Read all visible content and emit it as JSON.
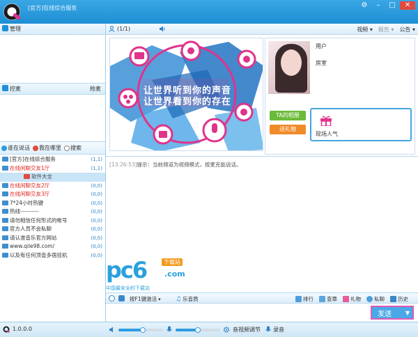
{
  "window": {
    "title": "[官方]在线综合服务",
    "controls": [
      "gear-icon",
      "minimize-icon",
      "maximize-icon",
      "close-icon"
    ]
  },
  "left_panel": {
    "admin_label": "管理",
    "mic_label": "控麦",
    "mic_right": "抢麦",
    "tabs": [
      {
        "label": "谁在说话",
        "icon": "speaker-icon",
        "color": "#2f9be0"
      },
      {
        "label": "我在哪里",
        "icon": "pin-icon",
        "color": "#e04a3f"
      },
      {
        "label": "搜索",
        "icon": "search-icon",
        "color": "#888888"
      }
    ],
    "rooms": [
      {
        "name": "[官方]在线综合服务",
        "count": "(1,1)",
        "style": "normal"
      },
      {
        "name": "在线闲聊交友1厅",
        "count": "(1,1)",
        "style": "red"
      },
      {
        "name": "软件大全",
        "count": "",
        "style": "sel"
      },
      {
        "name": "在线闲聊交友2厅",
        "count": "(0,0)",
        "style": "red"
      },
      {
        "name": "在线闲聊交友3厅",
        "count": "(0,0)",
        "style": "red"
      },
      {
        "name": "7*24小时热键",
        "count": "(0,0)",
        "style": "normal"
      },
      {
        "name": "热线----------",
        "count": "(0,0)",
        "style": "normal"
      },
      {
        "name": "请勿相信任何形式的帐号",
        "count": "(0,0)",
        "style": "normal"
      },
      {
        "name": "官方人员不会私聊",
        "count": "(0,0)",
        "style": "normal"
      },
      {
        "name": "请认准音乐官方网站",
        "count": "(0,0)",
        "style": "normal"
      },
      {
        "name": "www.qile98.com/",
        "count": "(0,0)",
        "style": "normal"
      },
      {
        "name": "以及有任何顶音多宿挂机",
        "count": "(0,0)",
        "style": "normal"
      }
    ]
  },
  "main": {
    "online_count": "(1/1)",
    "top_links": [
      {
        "label": "视频 ▾",
        "disabled": false
      },
      {
        "label": "报告 ▾",
        "disabled": true
      },
      {
        "label": "公告 ▾",
        "disabled": false
      }
    ],
    "banner": {
      "line1": "让世界听到你的声音",
      "line2": "让世界看到你的存在"
    },
    "profile": {
      "label_user": "用户",
      "label_rank": "房室"
    },
    "buttons": {
      "green": "TA的相册",
      "orange": "送礼物"
    },
    "popularity_label": "现场人气",
    "chat": {
      "timestamp": "[13:26:53]",
      "message": "提示：当前频道为视频模式，按麦克能说话。"
    },
    "watermark": {
      "brand": "pc6",
      "download": "下载站",
      "domain": ".com",
      "slogan": "中国最安全的下载站"
    },
    "toolbar": {
      "hotkey": "按F1键激活",
      "sound": "乐音质",
      "items": [
        "排行",
        "查章",
        "礼物",
        "私聊",
        "历史"
      ]
    },
    "send_label": "发送"
  },
  "bottom": {
    "version": "1.0.0.0",
    "av_settings": "音视频调节",
    "record": "录音",
    "volume_level": 0.55,
    "mic_level": 0.5
  },
  "colors": {
    "accent": "#1e8fd4",
    "red_room": "#e0261f",
    "banner_pink": "#e0338b",
    "send_border": "#e05ab5"
  }
}
